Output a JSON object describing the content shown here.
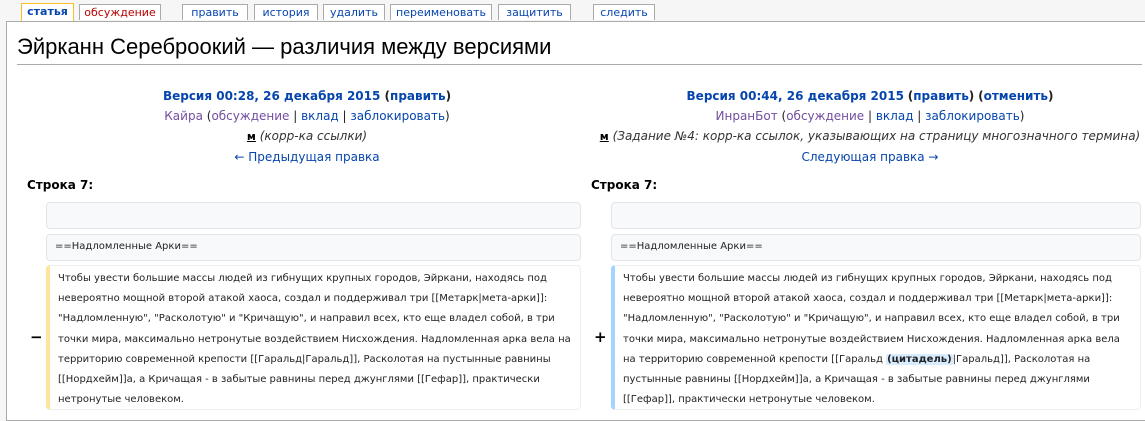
{
  "tabs": [
    {
      "label": "статья"
    },
    {
      "label": "обсуждение"
    },
    {
      "label": "править"
    },
    {
      "label": "история"
    },
    {
      "label": "удалить"
    },
    {
      "label": "переименовать"
    },
    {
      "label": "защитить"
    },
    {
      "label": "следить"
    }
  ],
  "title": "Эйрканн Сереброокий — различия между версиями",
  "left": {
    "version": "Версия 00:28, 26 декабря 2015",
    "edit_open": " (",
    "edit": "править",
    "edit_close": ")",
    "user": "Кайра",
    "talk": "обсуждение",
    "contribs": "вклад",
    "block": "заблокировать",
    "minor": "м",
    "summary": "(корр-ка ссылки)",
    "nav": "← Предыдущая правка",
    "line_label": "Строка 7:"
  },
  "right": {
    "version": "Версия 00:44, 26 декабря 2015",
    "edit": "править",
    "undo": "отменить",
    "user": "ИнранБот",
    "talk": "обсуждение",
    "contribs": "вклад",
    "block": "заблокировать",
    "minor": "м",
    "summary": "(Задание №4: корр-ка ссылок, указывающих на страницу многозначного термина)",
    "nav": "Следующая правка →",
    "line_label": "Строка 7:"
  },
  "diff": {
    "heading": "==Надломленные Арки==",
    "minus": "−",
    "plus": "+",
    "old_text": "Чтобы увести большие массы людей из гибнущих крупных городов, Эйркани, находясь под невероятно мощной второй атакой хаоса, создал и поддерживал три [[Метарк|мета-арки]]: \"Надломленную\", \"Расколотую\" и \"Кричащую\", и направил всех, кто еще владел собой, в три точки мира, максимально нетронутые воздействием Нисхождения. Надломленная арка вела на территорию современной крепости [[Гаральд|Гаральд]], Расколотая на пустынные равнины [[Нордхейм]]а, а Кричащая - в забытые равнины перед джунглями [[Гефар]], практически нетронутые человеком.",
    "new_text_before": "Чтобы увести большие массы людей из гибнущих крупных городов, Эйркани, находясь под невероятно мощной второй атакой хаоса, создал и поддерживал три [[Метарк|мета-арки]]: \"Надломленную\", \"Расколотую\" и \"Кричащую\", и направил всех, кто еще владел собой, в три точки мира, максимально нетронутые воздействием Нисхождения. Надломленная арка вела на территорию современной крепости [[Гаральд ",
    "new_text_highlight": "(цитадель)",
    "new_text_after": "|Гаральд]], Расколотая на пустынные равнины [[Нордхейм]]а, а Кричащая - в забытые равнины перед джунглями [[Гефар]], практически нетронутые человеком."
  }
}
